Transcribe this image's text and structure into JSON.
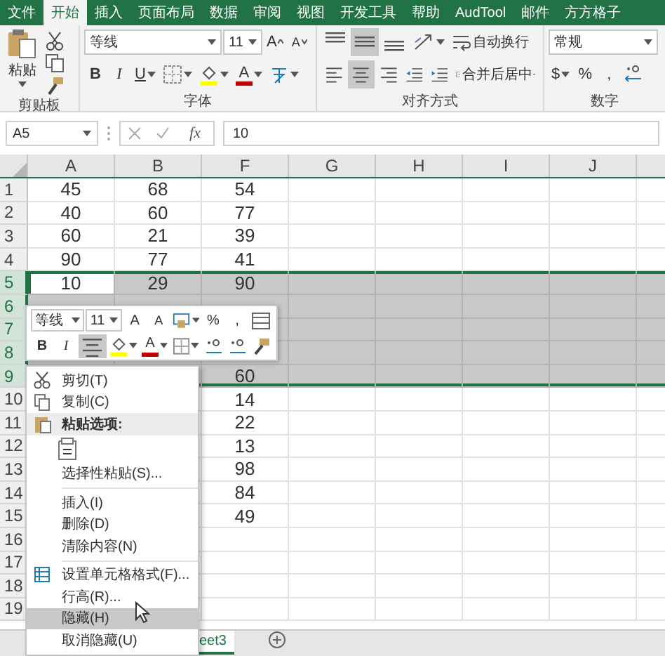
{
  "ribbon_tabs": [
    {
      "label": "文件",
      "selected": false
    },
    {
      "label": "开始",
      "selected": true
    },
    {
      "label": "插入",
      "selected": false
    },
    {
      "label": "页面布局",
      "selected": false
    },
    {
      "label": "数据",
      "selected": false
    },
    {
      "label": "审阅",
      "selected": false
    },
    {
      "label": "视图",
      "selected": false
    },
    {
      "label": "开发工具",
      "selected": false
    },
    {
      "label": "帮助",
      "selected": false
    },
    {
      "label": "AudTool",
      "selected": false
    },
    {
      "label": "邮件",
      "selected": false
    },
    {
      "label": "方方格子",
      "selected": false
    }
  ],
  "ribbon": {
    "clipboard": {
      "paste_label": "粘贴",
      "group_label": "剪贴板"
    },
    "font": {
      "font_name": "等线",
      "font_size": "11",
      "grow_font": "A",
      "shrink_font": "A",
      "bold": "B",
      "italic": "I",
      "underline": "U",
      "font_color": "A",
      "group_label": "字体"
    },
    "alignment": {
      "middle_align_on": true,
      "center_align_on": true,
      "wrap_text": "自动换行",
      "merge_center": "合并后居中",
      "group_label": "对齐方式"
    },
    "number": {
      "format": "常规",
      "currency": "$",
      "percent": "%",
      "comma": ",",
      "group_label": "数字"
    }
  },
  "formula_bar": {
    "name_box": "A5",
    "function_label": "fx",
    "value": "10"
  },
  "sheet": {
    "columns": [
      "A",
      "B",
      "F",
      "G",
      "H",
      "I",
      "J"
    ],
    "rows": [
      {
        "number": "1",
        "selected": false,
        "cells": {
          "a": {
            "value": "45",
            "active": false
          },
          "b": {
            "value": "68",
            "active": false
          },
          "f": {
            "value": "54",
            "active": false
          }
        }
      },
      {
        "number": "2",
        "selected": false,
        "cells": {
          "a": {
            "value": "40",
            "active": false
          },
          "b": {
            "value": "60",
            "active": false
          },
          "f": {
            "value": "77",
            "active": false
          }
        }
      },
      {
        "number": "3",
        "selected": false,
        "cells": {
          "a": {
            "value": "60",
            "active": false
          },
          "b": {
            "value": "21",
            "active": false
          },
          "f": {
            "value": "39",
            "active": false
          }
        }
      },
      {
        "number": "4",
        "selected": false,
        "cells": {
          "a": {
            "value": "90",
            "active": false
          },
          "b": {
            "value": "77",
            "active": false
          },
          "f": {
            "value": "41",
            "active": false
          }
        }
      },
      {
        "number": "5",
        "selected": true,
        "cells": {
          "a": {
            "value": "10",
            "active": true
          },
          "b": {
            "value": "29",
            "active": false
          },
          "f": {
            "value": "90",
            "active": false
          }
        }
      },
      {
        "number": "6",
        "selected": true
      },
      {
        "number": "7",
        "selected": true
      },
      {
        "number": "8",
        "selected": true
      },
      {
        "number": "9",
        "selected": true,
        "cells": {
          "f": {
            "value": "60",
            "active": false
          }
        }
      },
      {
        "number": "10",
        "selected": false,
        "cells": {
          "f": {
            "value": "14",
            "active": false
          }
        }
      },
      {
        "number": "11",
        "selected": false,
        "cells": {
          "f": {
            "value": "22",
            "active": false
          }
        }
      },
      {
        "number": "12",
        "selected": false,
        "cells": {
          "f": {
            "value": "13",
            "active": false
          }
        }
      },
      {
        "number": "13",
        "selected": false,
        "cells": {
          "f": {
            "value": "98",
            "active": false
          }
        }
      },
      {
        "number": "14",
        "selected": false,
        "cells": {
          "f": {
            "value": "84",
            "active": false
          }
        }
      },
      {
        "number": "15",
        "selected": false,
        "cells": {
          "f": {
            "value": "49",
            "active": false
          }
        }
      },
      {
        "number": "16",
        "selected": false
      },
      {
        "number": "17",
        "selected": false
      },
      {
        "number": "18",
        "selected": false
      },
      {
        "number": "19",
        "selected": false
      }
    ]
  },
  "mini_toolbar": {
    "font_name": "等线",
    "font_size": "11",
    "grow_font": "A",
    "shrink_font": "A",
    "percent": "%",
    "comma": ",",
    "bold": "B",
    "italic": "I",
    "center_align_on": true,
    "font_color": "A"
  },
  "context_menu": [
    {
      "kind": "cut",
      "label": "剪切(T)",
      "selected": false
    },
    {
      "kind": "copy",
      "label": "复制(C)",
      "selected": false
    },
    {
      "kind": "header",
      "label": "粘贴选项:"
    },
    {
      "kind": "paste",
      "selected": false
    },
    {
      "kind": "plain",
      "label": "选择性粘贴(S)...",
      "selected": false
    },
    {
      "kind": "separator"
    },
    {
      "kind": "plain",
      "label": "插入(I)",
      "selected": false
    },
    {
      "kind": "plain",
      "label": "删除(D)",
      "selected": false
    },
    {
      "kind": "plain",
      "label": "清除内容(N)",
      "selected": false
    },
    {
      "kind": "separator"
    },
    {
      "kind": "format",
      "label": "设置单元格格式(F)...",
      "selected": false
    },
    {
      "kind": "plain",
      "label": "行高(R)...",
      "selected": false
    },
    {
      "kind": "plain",
      "label": "隐藏(H)",
      "selected": true
    },
    {
      "kind": "plain",
      "label": "取消隐藏(U)",
      "selected": false
    }
  ],
  "sheet_tabs": [
    {
      "label": "eet3",
      "selected": true
    }
  ]
}
